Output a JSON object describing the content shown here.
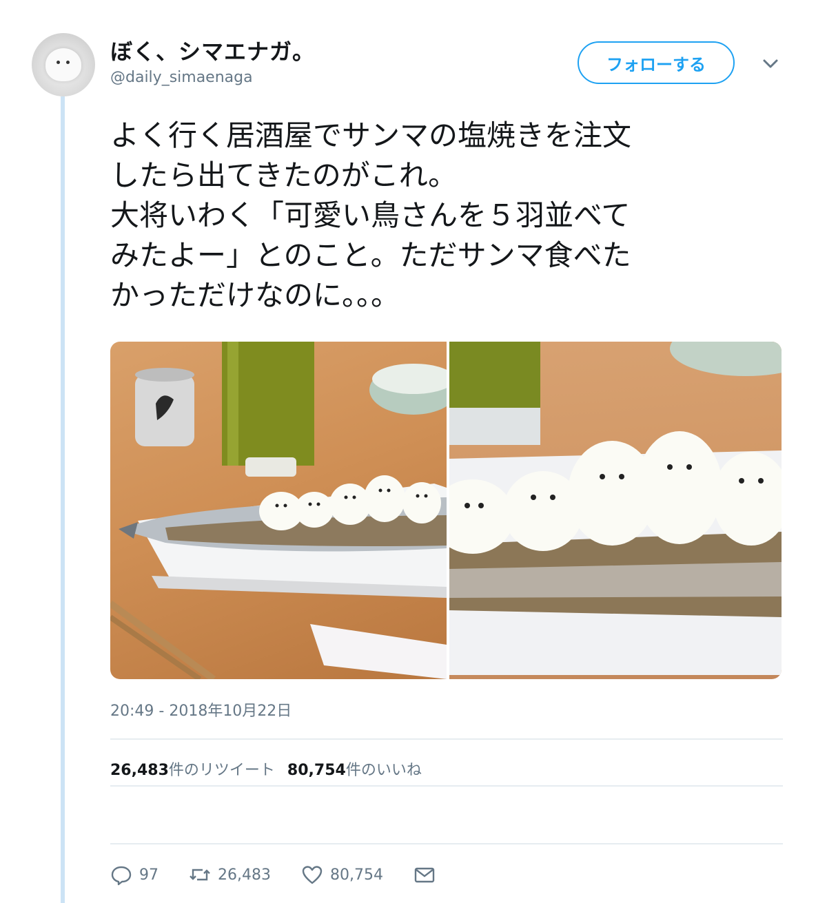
{
  "tweet": {
    "display_name": "ぼく、シマエナガ。",
    "handle": "@daily_simaenaga",
    "follow_label": "フォローする",
    "text_lines": [
      "よく行く居酒屋でサンマの塩焼きを注文",
      "したら出てきたのがこれ。",
      "大将いわく「可愛い鳥さんを５羽並べて",
      "みたよー」とのこと。ただサンマ食べた",
      "かっただけなのに。。。"
    ],
    "timestamp": "20:49 - 2018年10月22日",
    "retweet_count": "26,483",
    "retweet_label": "件のリツイート",
    "like_count": "80,754",
    "like_label": "件のいいね",
    "actions": {
      "reply_count": "97",
      "retweet_count": "26,483",
      "like_count": "80,754"
    }
  },
  "colors": {
    "accent": "#1da1f2",
    "muted": "#657786",
    "thread_line": "#cce3f5"
  }
}
